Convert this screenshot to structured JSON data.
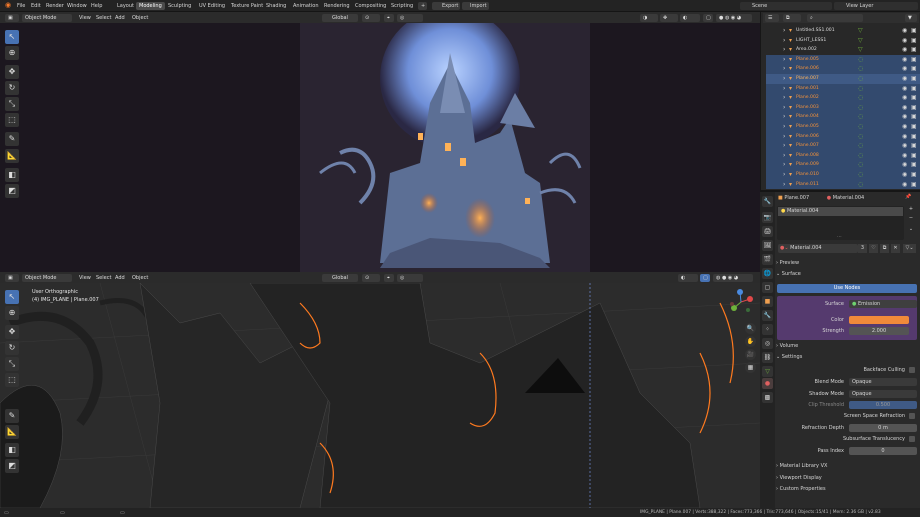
{
  "top_menu": [
    "File",
    "Edit",
    "Render",
    "Window",
    "Help"
  ],
  "workspaces": [
    "Layout",
    "Modeling",
    "Sculpting",
    "UV Editing",
    "Texture Paint",
    "Shading",
    "Animation",
    "Rendering",
    "Compositing",
    "Scripting"
  ],
  "active_workspace": "Modeling",
  "top_buttons": {
    "export": "Export",
    "import": "Import"
  },
  "scene": {
    "label": "Scene"
  },
  "view_layer": {
    "label": "View Layer"
  },
  "vp_top": {
    "mode": "Object Mode",
    "menu": [
      "View",
      "Select",
      "Add",
      "Object"
    ],
    "orientation": "Global"
  },
  "vp_bottom": {
    "mode": "Object Mode",
    "menu": [
      "View",
      "Select",
      "Add",
      "Object"
    ],
    "orientation": "Global",
    "view_name": "User Orthographic",
    "object_info": "(4) IMG_PLANE | Plane.007"
  },
  "outliner": {
    "rows": [
      {
        "name": "Untitled.SS1.001",
        "sel": false,
        "act": false
      },
      {
        "name": "LIGHT_LESS1",
        "sel": false,
        "act": false
      },
      {
        "name": "Area.002",
        "sel": false,
        "act": false
      },
      {
        "name": "Plane.005",
        "sel": true,
        "act": false
      },
      {
        "name": "Plane.006",
        "sel": true,
        "act": false
      },
      {
        "name": "Plane.007",
        "sel": true,
        "act": true
      },
      {
        "name": "Plane.001",
        "sel": true,
        "act": false
      },
      {
        "name": "Plane.002",
        "sel": true,
        "act": false
      },
      {
        "name": "Plane.003",
        "sel": true,
        "act": false
      },
      {
        "name": "Plane.004",
        "sel": true,
        "act": false
      },
      {
        "name": "Plane.005",
        "sel": true,
        "act": false
      },
      {
        "name": "Plane.006",
        "sel": true,
        "act": false
      },
      {
        "name": "Plane.007",
        "sel": true,
        "act": false
      },
      {
        "name": "Plane.008",
        "sel": true,
        "act": false
      },
      {
        "name": "Plane.009",
        "sel": true,
        "act": false
      },
      {
        "name": "Plane.010",
        "sel": true,
        "act": false
      },
      {
        "name": "Plane.011",
        "sel": true,
        "act": false
      }
    ]
  },
  "properties": {
    "breadcrumb_object": "Plane.007",
    "breadcrumb_material": "Material.004",
    "slot_material": "Material.004",
    "material_field": "Material.004",
    "user_count": "3",
    "panels": {
      "preview": "Preview",
      "surface": "Surface",
      "volume": "Volume",
      "settings": "Settings",
      "mat_library": "Material Library VX",
      "viewport_display": "Viewport Display",
      "custom_props": "Custom Properties"
    },
    "use_nodes": "Use Nodes",
    "surface_label": "Surface",
    "surface_value": "Emission",
    "color_label": "Color",
    "color_value": "#f08a3a",
    "strength_label": "Strength",
    "strength_value": "2.000",
    "backface": "Backface Culling",
    "blend_label": "Blend Mode",
    "blend_value": "Opaque",
    "shadow_label": "Shadow Mode",
    "shadow_value": "Opaque",
    "clip_label": "Clip Threshold",
    "clip_value": "0.500",
    "ssr": "Screen Space Refraction",
    "refr_label": "Refraction Depth",
    "refr_value": "0 m",
    "sss": "Subsurface Translucency",
    "pass_label": "Pass Index",
    "pass_value": "0"
  },
  "status": {
    "text": "IMG_PLANE | Plane.007 | Verts:388,322 | Faces:773,366 | Tris:773,646 | Objects:15/41 | Mem: 2.36 GB | v2.83"
  },
  "colors": {
    "accent": "#4772b3",
    "selected_row": "#334a6e",
    "emission_orange": "#f08a3a",
    "surface_purple": "#553a6e"
  }
}
